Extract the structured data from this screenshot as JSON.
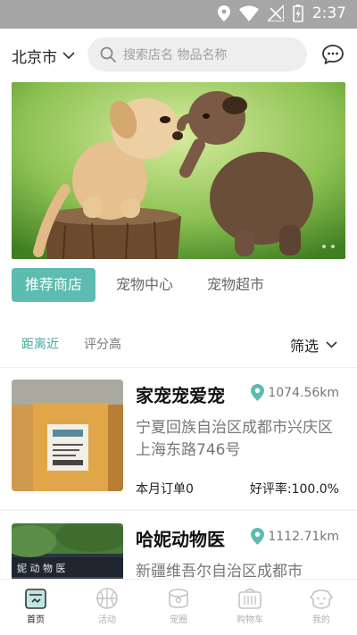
{
  "status_bar": {
    "time": "2:37"
  },
  "header": {
    "city": "北京市",
    "search_placeholder": "搜索店名 物品名称"
  },
  "category_tabs": [
    {
      "label": "推荐商店",
      "active": true
    },
    {
      "label": "宠物中心",
      "active": false
    },
    {
      "label": "宠物超市",
      "active": false
    }
  ],
  "sort": {
    "distance_label": "距离近",
    "rating_label": "评分高",
    "filter_label": "筛选"
  },
  "shops": [
    {
      "name": "家宠宠爱宠",
      "distance": "1074.56km",
      "address": "宁夏回族自治区成都市兴庆区上海东路746号",
      "orders": "本月订单0",
      "rating": "好评率:100.0%"
    },
    {
      "name": "哈妮动物医",
      "distance": "1112.71km",
      "address": "新疆维吾尔自治区成都市"
    }
  ],
  "bottom_nav": [
    {
      "label": "首页",
      "icon": "home-icon",
      "active": true
    },
    {
      "label": "活动",
      "icon": "basketball-icon",
      "active": false
    },
    {
      "label": "宠圈",
      "icon": "pet-circle-icon",
      "active": false
    },
    {
      "label": "购物车",
      "icon": "pet-carrier-icon",
      "active": false
    },
    {
      "label": "我的",
      "icon": "dog-face-icon",
      "active": false
    }
  ],
  "colors": {
    "accent": "#5cbcb0",
    "status_bar": "#a6a6a6"
  }
}
